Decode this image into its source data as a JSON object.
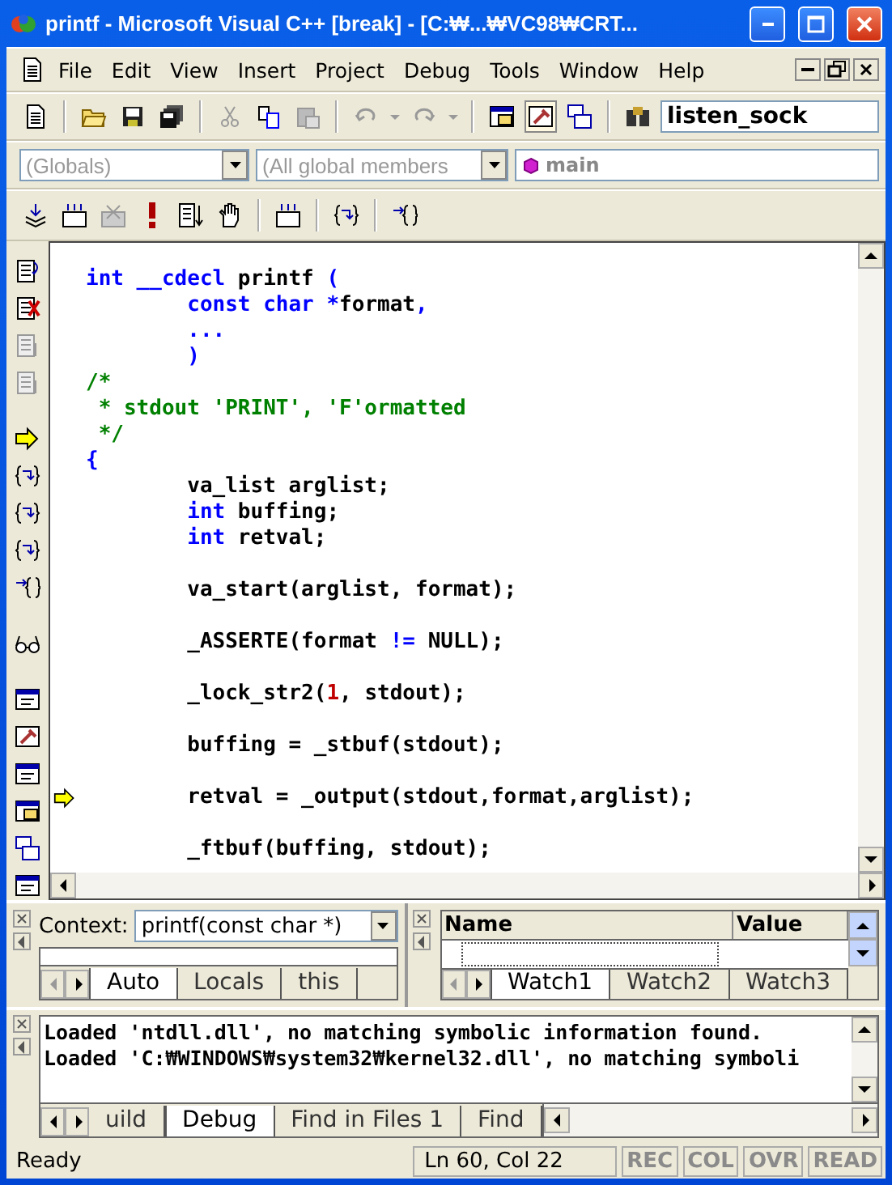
{
  "window": {
    "title": "printf - Microsoft Visual C++ [break] - [C:₩...₩VC98₩CRT..."
  },
  "menu": [
    "File",
    "Edit",
    "View",
    "Insert",
    "Project",
    "Debug",
    "Tools",
    "Window",
    "Help"
  ],
  "toolbar": {
    "find_combo": {
      "value": "listen_sock"
    }
  },
  "wizard_bar": {
    "class_combo": {
      "value": "(Globals)",
      "disabled": true
    },
    "filter_combo": {
      "value": "(All global members",
      "disabled": true
    },
    "members_combo": {
      "value": "main"
    }
  },
  "editor": {
    "lines": [
      {
        "kind": "code",
        "current": false,
        "segments": [
          {
            "kind": "keyword",
            "text": "int __cdecl"
          },
          {
            "kind": "plain",
            "text": " printf "
          },
          {
            "kind": "keyword",
            "text": "("
          }
        ]
      },
      {
        "kind": "code",
        "current": false,
        "segments": [
          {
            "kind": "keyword",
            "text": "        const char *"
          },
          {
            "kind": "plain",
            "text": "format"
          },
          {
            "kind": "keyword",
            "text": ","
          }
        ]
      },
      {
        "kind": "code",
        "current": false,
        "segments": [
          {
            "kind": "keyword",
            "text": "        ..."
          }
        ]
      },
      {
        "kind": "code",
        "current": false,
        "segments": [
          {
            "kind": "keyword",
            "text": "        )"
          }
        ]
      },
      {
        "kind": "code",
        "current": false,
        "segments": [
          {
            "kind": "comment",
            "text": "/*"
          }
        ]
      },
      {
        "kind": "code",
        "current": false,
        "segments": [
          {
            "kind": "comment",
            "text": " * stdout 'PRINT', 'F'ormatted"
          }
        ]
      },
      {
        "kind": "code",
        "current": false,
        "segments": [
          {
            "kind": "comment",
            "text": " */"
          }
        ]
      },
      {
        "kind": "code",
        "current": false,
        "segments": [
          {
            "kind": "keyword",
            "text": "{"
          }
        ]
      },
      {
        "kind": "code",
        "current": false,
        "segments": [
          {
            "kind": "plain",
            "text": "        va_list arglist;"
          }
        ]
      },
      {
        "kind": "code",
        "current": false,
        "segments": [
          {
            "kind": "keyword",
            "text": "        int"
          },
          {
            "kind": "plain",
            "text": " buffing;"
          }
        ]
      },
      {
        "kind": "code",
        "current": false,
        "segments": [
          {
            "kind": "keyword",
            "text": "        int"
          },
          {
            "kind": "plain",
            "text": " retval;"
          }
        ]
      },
      {
        "kind": "blank"
      },
      {
        "kind": "code",
        "current": false,
        "segments": [
          {
            "kind": "plain",
            "text": "        va_start(arglist, format);"
          }
        ]
      },
      {
        "kind": "blank"
      },
      {
        "kind": "code",
        "current": false,
        "segments": [
          {
            "kind": "plain",
            "text": "        _ASSERTE(format "
          },
          {
            "kind": "keyword",
            "text": "!="
          },
          {
            "kind": "plain",
            "text": " NULL);"
          }
        ]
      },
      {
        "kind": "blank"
      },
      {
        "kind": "code",
        "current": false,
        "segments": [
          {
            "kind": "plain",
            "text": "        _lock_str2("
          },
          {
            "kind": "number",
            "text": "1"
          },
          {
            "kind": "plain",
            "text": ", stdout);"
          }
        ]
      },
      {
        "kind": "blank"
      },
      {
        "kind": "code",
        "current": false,
        "segments": [
          {
            "kind": "plain",
            "text": "        buffing = _stbuf(stdout);"
          }
        ]
      },
      {
        "kind": "blank"
      },
      {
        "kind": "code",
        "current": true,
        "segments": [
          {
            "kind": "plain",
            "text": "        retval = _output(stdout,format,arglist);"
          }
        ]
      },
      {
        "kind": "blank"
      },
      {
        "kind": "code",
        "current": false,
        "segments": [
          {
            "kind": "plain",
            "text": "        _ftbuf(buffing, stdout);"
          }
        ]
      }
    ]
  },
  "variables_pane": {
    "context_label": "Context:",
    "context_value": "printf(const char *)",
    "tabs": [
      {
        "label": "Auto",
        "selected": true
      },
      {
        "label": "Locals",
        "selected": false
      },
      {
        "label": "this",
        "selected": false
      }
    ]
  },
  "watch_pane": {
    "columns": [
      "Name",
      "Value"
    ],
    "tabs": [
      {
        "label": "Watch1",
        "selected": true
      },
      {
        "label": "Watch2",
        "selected": false
      },
      {
        "label": "Watch3",
        "selected": false
      }
    ]
  },
  "output_pane": {
    "lines": [
      "Loaded 'ntdll.dll', no matching symbolic information found.",
      "Loaded 'C:₩WINDOWS₩system32₩kernel32.dll', no matching symboli"
    ],
    "tabs": [
      {
        "label": "uild",
        "selected": false
      },
      {
        "label": "Debug",
        "selected": true
      },
      {
        "label": "Find in Files 1",
        "selected": false
      },
      {
        "label": "Find",
        "selected": false
      }
    ]
  },
  "status_bar": {
    "message": "Ready",
    "position": "Ln 60, Col 22",
    "indicators": [
      {
        "label": "REC",
        "on": false
      },
      {
        "label": "COL",
        "on": false
      },
      {
        "label": "OVR",
        "on": false
      },
      {
        "label": "READ",
        "on": false
      }
    ]
  }
}
